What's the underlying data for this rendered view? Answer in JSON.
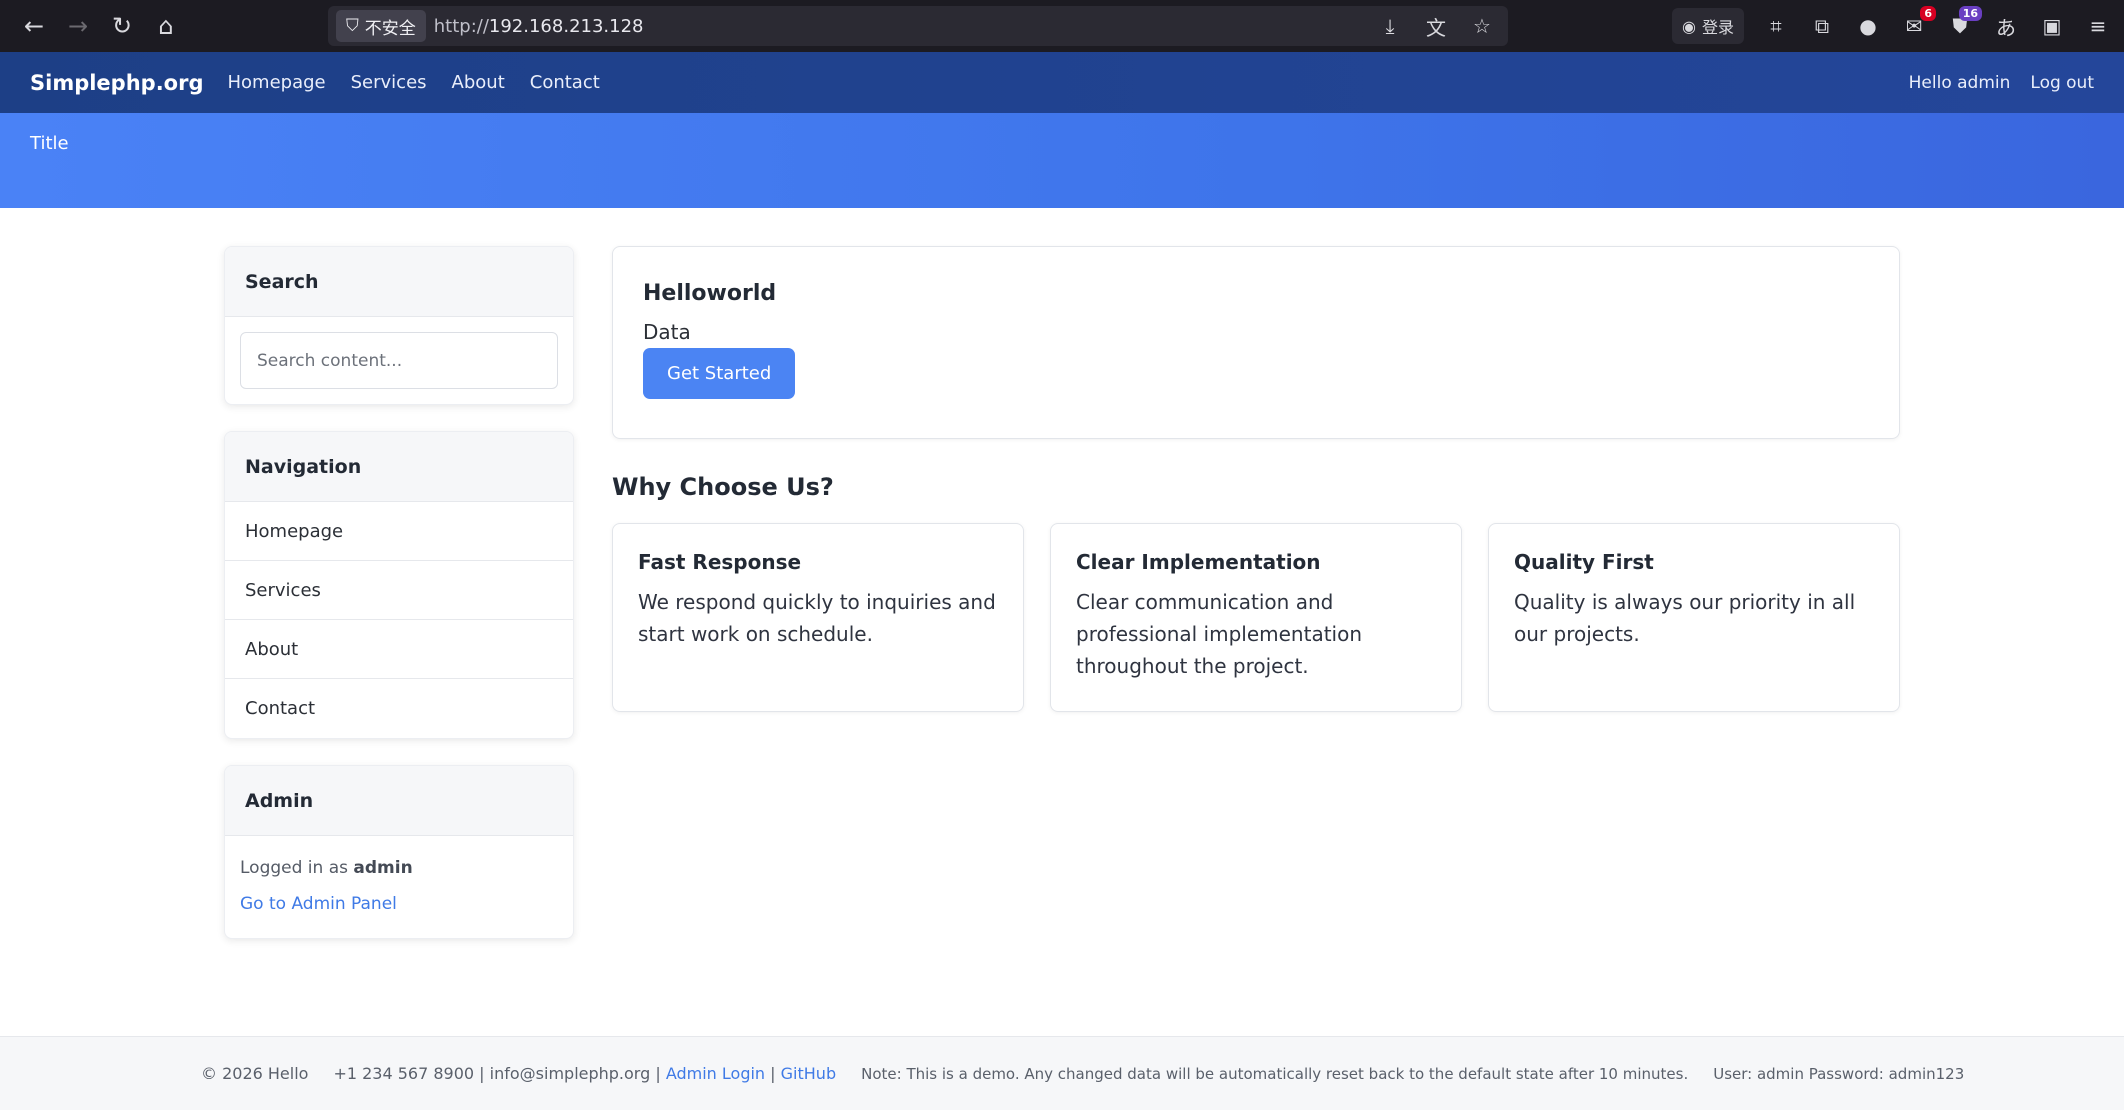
{
  "browser": {
    "security_label": "不安全",
    "url_scheme": "http://",
    "url_host": "192.168.213.128",
    "login_label": "登录",
    "badge_mail": "6",
    "badge_ext": "16"
  },
  "navbar": {
    "brand": "Simplephp.org",
    "links": [
      "Homepage",
      "Services",
      "About",
      "Contact"
    ],
    "greeting": "Hello admin",
    "logout": "Log out"
  },
  "hero": {
    "title": "Title"
  },
  "sidebar": {
    "search": {
      "title": "Search",
      "placeholder": "Search content..."
    },
    "navigation": {
      "title": "Navigation",
      "items": [
        "Homepage",
        "Services",
        "About",
        "Contact"
      ]
    },
    "admin": {
      "title": "Admin",
      "logged_prefix": "Logged in as",
      "username": "admin",
      "panel_link": "Go to Admin Panel"
    }
  },
  "main": {
    "hello": {
      "title": "Helloworld",
      "data": "Data",
      "button": "Get Started"
    },
    "why_title": "Why Choose Us?",
    "features": [
      {
        "title": "Fast Response",
        "text": "We respond quickly to inquiries and start work on schedule."
      },
      {
        "title": "Clear Implementation",
        "text": "Clear communication and professional implementation throughout the project."
      },
      {
        "title": "Quality First",
        "text": "Quality is always our priority in all our projects."
      }
    ]
  },
  "footer": {
    "copyright": "© 2026 Hello",
    "contact": "+1 234 567 8900 | info@simplephp.org |",
    "admin_login": "Admin Login",
    "sep": "|",
    "github": "GitHub",
    "note": "Note: This is a demo. Any changed data will be automatically reset back to the default state after 10 minutes.",
    "credentials": "User: admin Password: admin123"
  },
  "colors": {
    "navbar": "#1d3f86",
    "hero": "#4a82f6",
    "primary": "#4b84f3",
    "link": "#3f7ae6"
  }
}
